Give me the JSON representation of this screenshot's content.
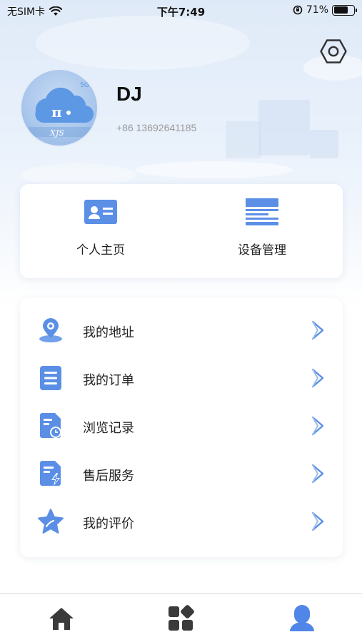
{
  "status_bar": {
    "carrier": "无SIM卡",
    "time": "下午7:49",
    "battery_percent": "71%",
    "battery_level": 0.71
  },
  "profile": {
    "username": "DJ",
    "phone": "+86 13692641185",
    "avatar_text": "XJS"
  },
  "quick_actions": [
    {
      "label": "个人主页",
      "icon": "id-card-icon"
    },
    {
      "label": "设备管理",
      "icon": "device-icon"
    }
  ],
  "menu": [
    {
      "label": "我的地址",
      "icon": "location-pin-icon"
    },
    {
      "label": "我的订单",
      "icon": "order-list-icon"
    },
    {
      "label": "浏览记录",
      "icon": "history-icon"
    },
    {
      "label": "售后服务",
      "icon": "after-sales-icon"
    },
    {
      "label": "我的评价",
      "icon": "star-icon"
    }
  ],
  "tab_bar": [
    {
      "name": "home-icon",
      "active": false
    },
    {
      "name": "apps-icon",
      "active": false
    },
    {
      "name": "profile-icon",
      "active": true
    }
  ],
  "colors": {
    "accent": "#5b8fe6",
    "tab_inactive": "#3a3a3a",
    "tab_active": "#4f86e8"
  }
}
